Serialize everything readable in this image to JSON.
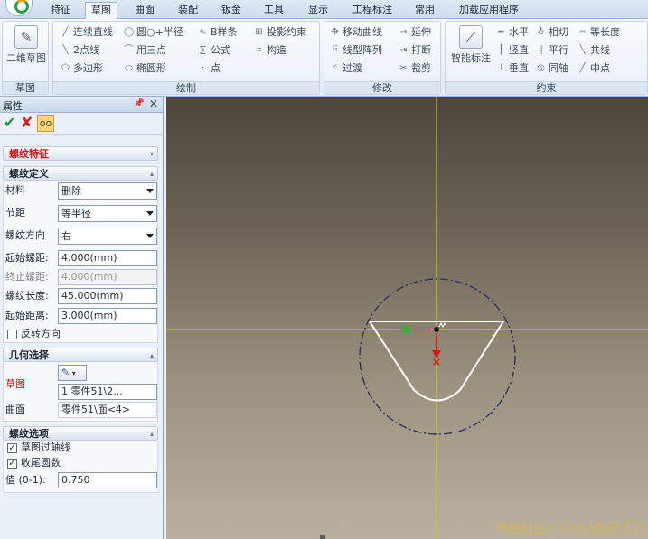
{
  "tabs": [
    "特征",
    "草图",
    "曲面",
    "装配",
    "钣金",
    "工具",
    "显示",
    "工程标注",
    "常用",
    "加载应用程序"
  ],
  "active_tab": "草图",
  "ribbon": {
    "sketch_group": {
      "title": "草图",
      "button": "二维草图"
    },
    "draw_group": {
      "title": "绘制",
      "items": [
        "连续直线",
        "圆○+半径",
        "B样条",
        "投影约束",
        "2点线",
        "用三点",
        "公式",
        "构造",
        "多边形",
        "椭圆形",
        "点"
      ]
    },
    "modify_group": {
      "title": "修改",
      "items": [
        "移动曲线",
        "延伸",
        "线型阵列",
        "打断",
        "过渡",
        "裁剪"
      ]
    },
    "constraint_group": {
      "title": "约束",
      "button": "智能标注",
      "items": [
        "水平",
        "相切",
        "等长度",
        "竖直",
        "平行",
        "共线",
        "垂直",
        "同轴",
        "中点"
      ]
    }
  },
  "panel": {
    "title": "属性",
    "feature_title": "螺纹特征",
    "definition": {
      "title": "螺纹定义",
      "material_label": "材料",
      "material_value": "删除",
      "pitch_label": "节距",
      "pitch_value": "等半径",
      "direction_label": "螺纹方向",
      "direction_value": "右",
      "start_pitch_label": "起始螺距:",
      "start_pitch_value": "4.000(mm)",
      "end_pitch_label": "终止螺距:",
      "end_pitch_value": "4.000(mm)",
      "length_label": "螺纹长度:",
      "length_value": "45.000(mm)",
      "start_dist_label": "起始距离:",
      "start_dist_value": "3.000(mm)",
      "reverse_label": "反转方向"
    },
    "geometry": {
      "title": "几何选择",
      "sketch_label": "草图",
      "sketch_value": "1    零件51\\2...",
      "surface_label": "曲面",
      "surface_value": "零件51\\面<4>"
    },
    "options": {
      "title": "螺纹选项",
      "sketch_axis_label": "草图过轴线",
      "taper_label": "收尾圆数",
      "value_label": "值 (0-1):",
      "value": "0.750"
    }
  },
  "viewport": {
    "watermark": "神迷社区 | CAXA数码大方"
  },
  "colors": {
    "axis": "#c8cc33",
    "circle": "#2e3466",
    "profile": "#ffffff",
    "arrow_green": "#22bb22",
    "arrow_red": "#dd1111"
  }
}
